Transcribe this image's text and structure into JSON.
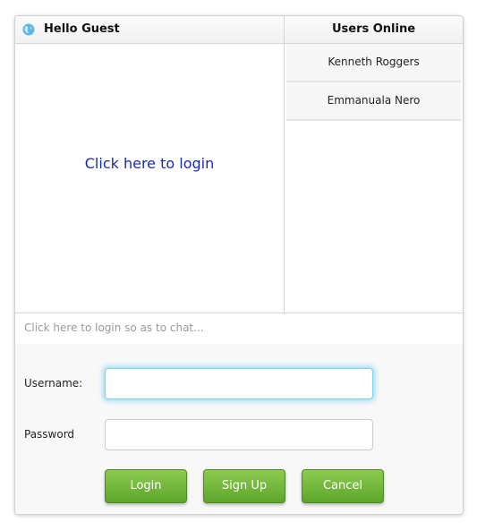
{
  "header": {
    "title": "Hello Guest",
    "users_title": "Users Online"
  },
  "main": {
    "login_link": "Click here to login"
  },
  "users": [
    {
      "name": "Kenneth Roggers"
    },
    {
      "name": "Emmanuala Nero"
    }
  ],
  "chat_input": {
    "placeholder": "Click here to login so as to chat..."
  },
  "form": {
    "username_label": "Username:",
    "username_value": "",
    "password_label": "Password",
    "password_value": "",
    "buttons": {
      "login": "Login",
      "signup": "Sign Up",
      "cancel": "Cancel"
    }
  },
  "icons": {
    "header": "globe-icon"
  },
  "colors": {
    "link": "#1a2ab8",
    "button_green": "#6db33f",
    "focus_glow": "#5ac8f0"
  }
}
